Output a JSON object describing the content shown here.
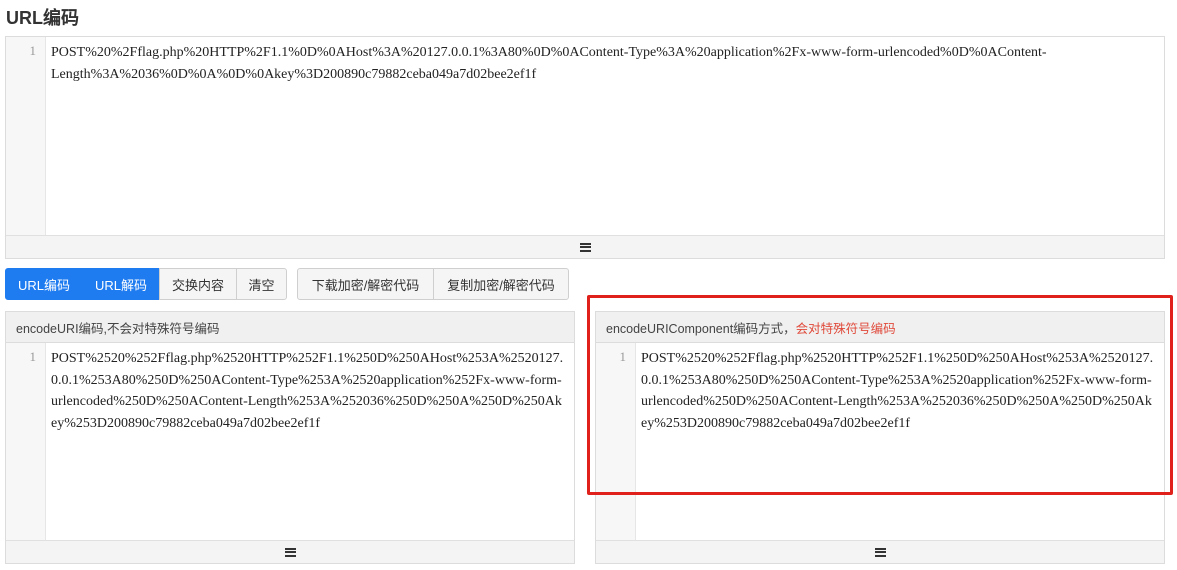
{
  "page": {
    "title": "URL编码"
  },
  "input_editor": {
    "line_number": "1",
    "text": "POST%20%2Fflag.php%20HTTP%2F1.1%0D%0AHost%3A%20127.0.0.1%3A80%0D%0AContent-Type%3A%20application%2Fx-www-form-urlencoded%0D%0AContent-Length%3A%2036%0D%0A%0D%0Akey%3D200890c79882ceba049a7d02bee2ef1f"
  },
  "toolbar": {
    "encode_label": "URL编码",
    "decode_label": "URL解码",
    "swap_label": "交换内容",
    "clear_label": "清空",
    "download_label": "下载加密/解密代码",
    "copy_label": "复制加密/解密代码"
  },
  "left_panel": {
    "header": "encodeURI编码,不会对特殊符号编码",
    "line_number": "1",
    "text": "POST%2520%252Fflag.php%2520HTTP%252F1.1%250D%250AHost%253A%2520127.0.0.1%253A80%250D%250AContent-Type%253A%2520application%252Fx-www-form-urlencoded%250D%250AContent-Length%253A%252036%250D%250A%250D%250Akey%253D200890c79882ceba049a7d02bee2ef1f"
  },
  "right_panel": {
    "header_prefix": "encodeURIComponent编码方式，",
    "header_highlight": "会对特殊符号编码",
    "line_number": "1",
    "text": "POST%2520%252Fflag.php%2520HTTP%252F1.1%250D%250AHost%253A%2520127.0.0.1%253A80%250D%250AContent-Type%253A%2520application%252Fx-www-form-urlencoded%250D%250AContent-Length%253A%252036%250D%250A%250D%250Akey%253D200890c79882ceba049a7d02bee2ef1f"
  },
  "colors": {
    "accent": "#1e7bf0",
    "highlight_text": "#e04a3b",
    "annotation_box": "#e0201a"
  },
  "icons": {
    "resize_handle": "hamburger-icon"
  }
}
